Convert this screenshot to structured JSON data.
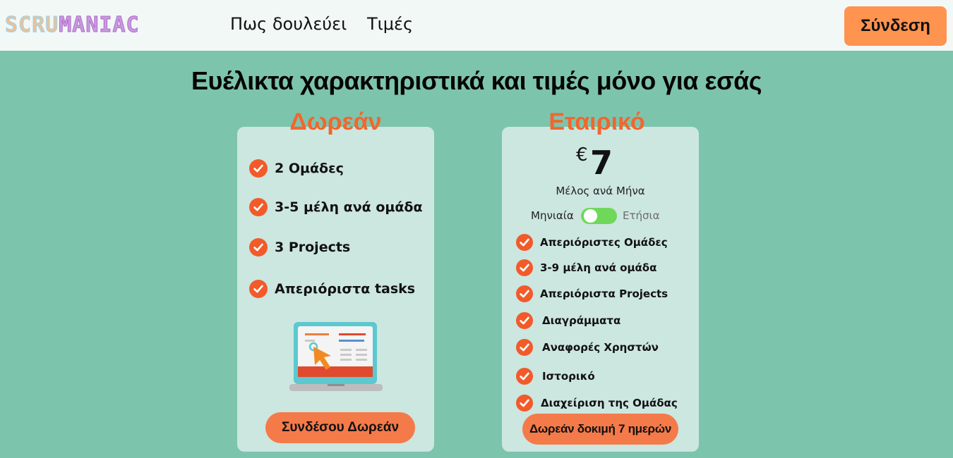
{
  "brand": {
    "logo_part1": "SCRU",
    "logo_part2": "MANIAC"
  },
  "nav": {
    "how_it_works": "Πως δουλεύει",
    "pricing": "Τιμές",
    "login": "Σύνδεση"
  },
  "headline": "Ευέλικτα χαρακτηριστικά και τιμές μόνο για εσάς",
  "free_plan": {
    "title": "Δωρεάν",
    "features": [
      "2 Ομάδες",
      "3-5 μέλη ανά ομάδα",
      "3 Projects",
      "Απεριόριστα tasks"
    ],
    "cta": "Συνδέσου Δωρεάν"
  },
  "business_plan": {
    "title": "Εταιρικό",
    "currency": "€",
    "price": "7",
    "price_unit": "Μέλος ανά Μήνα",
    "billing": {
      "monthly": "Μηνιαία",
      "yearly": "Ετήσια",
      "selected": "Μηνιαία"
    },
    "features": [
      "Απεριόριστες Ομάδες",
      "3-9 μέλη ανά ομάδα",
      "Απεριόριστα Projects",
      "Διαγράμματα",
      "Αναφορές Χρηστών",
      "Ιστορικό",
      "Διαχείριση της Ομάδας"
    ],
    "cta": "Δωρεάν δοκιμή 7 ημερών"
  },
  "colors": {
    "background": "#7dc4ad",
    "card": "#cce6e0",
    "accent": "#f2662d",
    "button": "#f57a49",
    "login_button": "#ff9350",
    "toggle": "#6fd85a"
  },
  "icons": {
    "check": "check-circle-icon",
    "illustration": "laptop-cursor-illustration"
  }
}
